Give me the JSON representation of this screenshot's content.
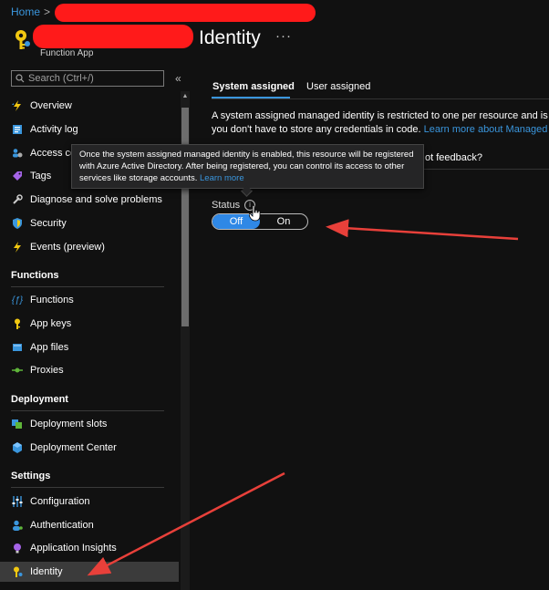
{
  "header": {
    "breadcrumb_home": "Home",
    "breadcrumb_sep": ">",
    "title": "Identity",
    "more_label": "···",
    "subtitle": "Function App"
  },
  "sidebar": {
    "search_placeholder": "Search (Ctrl+/)",
    "collapse_label": "«",
    "top_items": [
      {
        "label": "Overview",
        "icon": "lightning-icon"
      },
      {
        "label": "Activity log",
        "icon": "log-icon"
      },
      {
        "label": "Access control (IAM)",
        "icon": "people-icon"
      },
      {
        "label": "Tags",
        "icon": "tag-icon"
      },
      {
        "label": "Diagnose and solve problems",
        "icon": "wrench-icon"
      },
      {
        "label": "Security",
        "icon": "shield-icon"
      },
      {
        "label": "Events (preview)",
        "icon": "bolt-icon"
      }
    ],
    "sections": [
      {
        "title": "Functions",
        "items": [
          {
            "label": "Functions",
            "icon": "function-icon"
          },
          {
            "label": "App keys",
            "icon": "key-icon"
          },
          {
            "label": "App files",
            "icon": "files-icon"
          },
          {
            "label": "Proxies",
            "icon": "proxy-icon"
          }
        ]
      },
      {
        "title": "Deployment",
        "items": [
          {
            "label": "Deployment slots",
            "icon": "slots-icon"
          },
          {
            "label": "Deployment Center",
            "icon": "cube-icon"
          }
        ]
      },
      {
        "title": "Settings",
        "items": [
          {
            "label": "Configuration",
            "icon": "sliders-icon"
          },
          {
            "label": "Authentication",
            "icon": "person-icon"
          },
          {
            "label": "Application Insights",
            "icon": "bulb-icon"
          },
          {
            "label": "Identity",
            "icon": "identity-key-icon",
            "active": true
          }
        ]
      }
    ]
  },
  "main": {
    "tabs": [
      {
        "label": "System assigned",
        "active": true
      },
      {
        "label": "User assigned",
        "active": false
      }
    ],
    "description_line1": "A system assigned managed identity is restricted to one per resource and is tied",
    "description_line2_text": "you don't have to store any credentials in code. ",
    "description_link": "Learn more about Managed ide",
    "feedback_partial": "ot feedback?",
    "status_label": "Status",
    "toggle_off": "Off",
    "toggle_on": "On",
    "toggle_selected": "Off"
  },
  "tooltip": {
    "line1": "Once the system assigned managed identity is enabled, this resource will be registered",
    "line2": "with Azure Active Directory. After being registered, you can control its access to other",
    "line3_text": "services like storage accounts. ",
    "line3_link": "Learn more"
  },
  "colors": {
    "background": "#111111",
    "accent": "#3a96dd",
    "toggle_selected": "#2f88e6",
    "annotation": "#e8403a",
    "redaction": "#ff1a1a"
  }
}
